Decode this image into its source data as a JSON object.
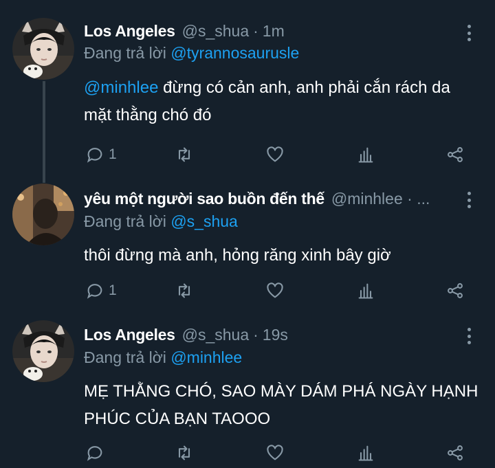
{
  "tweets": [
    {
      "name": "Los Angeles",
      "handle": "@s_shua",
      "separator": "·",
      "time": "1m",
      "reply_prefix": "Đang trả lời",
      "reply_to": "@tyrannosaurusle",
      "body_mention": "@minhlee",
      "body_text": " đừng có cản anh, anh phải cắn rách da mặt thằng chó đó",
      "reply_count": "1"
    },
    {
      "name": "yêu một người sao buồn đến thế",
      "handle": "@minhlee · ...",
      "reply_prefix": "Đang trả lời",
      "reply_to": "@s_shua",
      "body_text": "thôi đừng mà anh, hỏng răng xinh bây giờ",
      "reply_count": "1"
    },
    {
      "name": "Los Angeles",
      "handle": "@s_shua",
      "separator": "·",
      "time": "19s",
      "reply_prefix": "Đang trả lời",
      "reply_to": "@minhlee",
      "body_text": "MẸ THẰNG CHÓ, SAO MÀY DÁM PHÁ NGÀY HẠNH PHÚC CỦA BẠN TAOOO",
      "reply_count": ""
    }
  ],
  "colors": {
    "background": "#15202b",
    "secondary_text": "#8899a6",
    "link": "#1da1f2",
    "thread_line": "#38444d"
  },
  "icons": [
    "reply-icon",
    "retweet-icon",
    "like-icon",
    "stats-icon",
    "share-icon",
    "more-icon"
  ]
}
